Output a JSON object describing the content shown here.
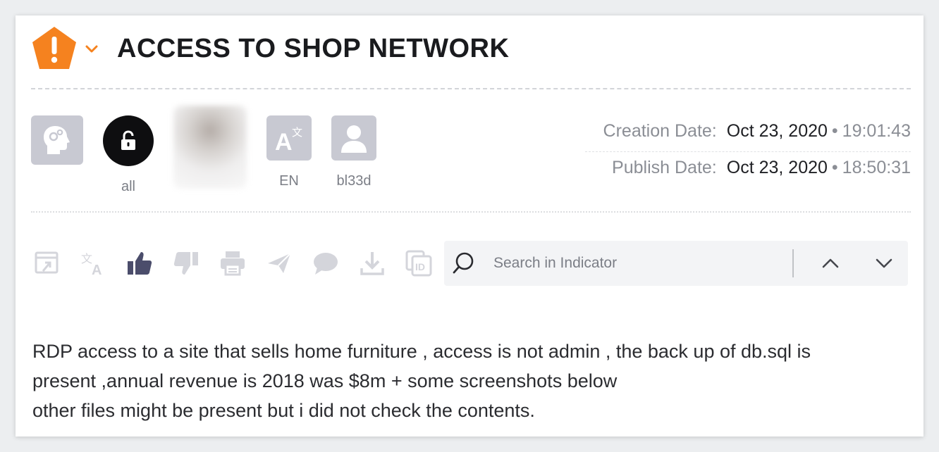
{
  "post": {
    "title": "ACCESS TO SHOP NETWORK",
    "severity_color": "#f5821f"
  },
  "meta": {
    "access_label": "all",
    "language_label": "EN",
    "author_label": "bl33d"
  },
  "dates": {
    "creation_label": "Creation Date:",
    "creation_date": "Oct 23, 2020",
    "creation_time": "19:01:43",
    "publish_label": "Publish Date:",
    "publish_date": "Oct 23, 2020",
    "publish_time": "18:50:31",
    "separator": "•"
  },
  "search": {
    "placeholder": "Search in Indicator",
    "value": ""
  },
  "description": {
    "line1": "RDP access to a site that sells home furniture , access is not admin , the back up of db.sql is",
    "line2": "present ,annual revenue is 2018 was $8m + some screenshots below",
    "line3": "other files might be present but i did not check the contents."
  },
  "icons": {
    "severity": "alert-pentagon-icon",
    "ai": "head-gears-icon",
    "lock": "lock-icon",
    "translate": "translate-icon",
    "user": "user-icon",
    "toolbar": [
      "open-external-icon",
      "translate-icon",
      "thumbs-up-icon",
      "thumbs-down-icon",
      "print-icon",
      "send-icon",
      "comment-icon",
      "download-icon",
      "copy-id-icon"
    ]
  },
  "colors": {
    "accent_orange": "#f5821f",
    "icon_gray": "#c8c9d2",
    "thumb_active": "#4b4d6b",
    "toolbar_muted": "#d4d5db"
  }
}
